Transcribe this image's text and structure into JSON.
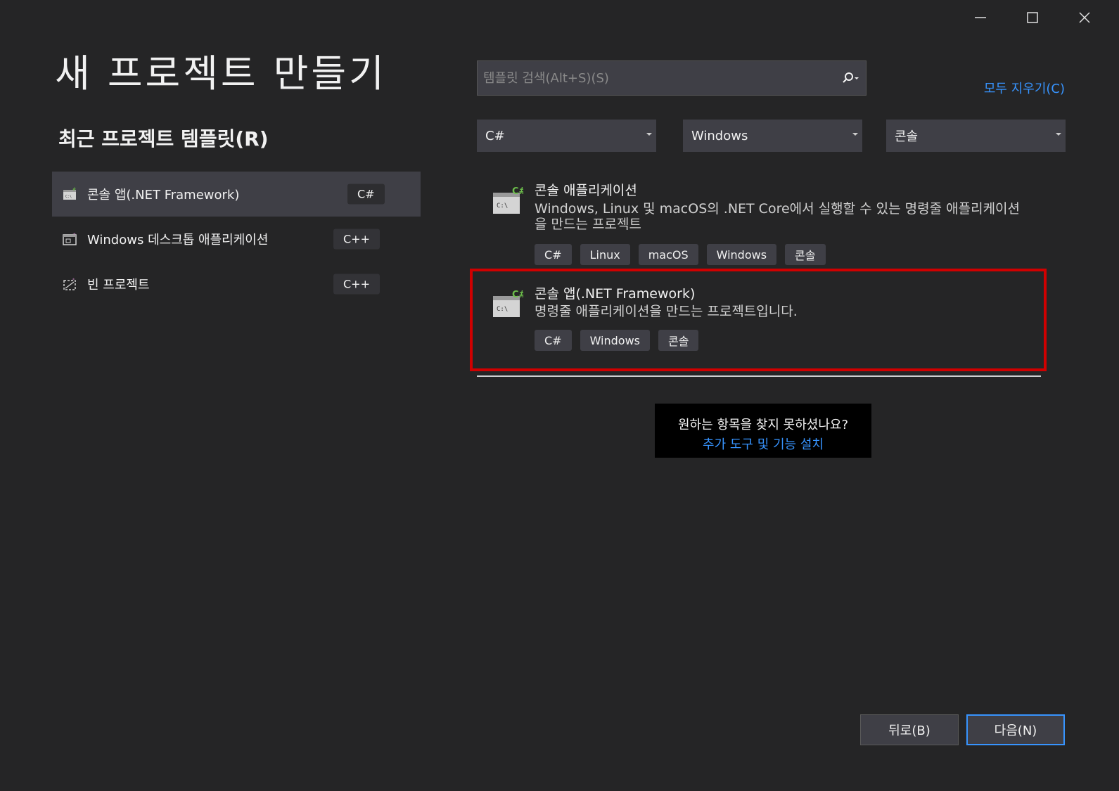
{
  "window": {
    "title": "새 프로젝트 만들기",
    "controls": [
      "minimize-icon",
      "maximize-icon",
      "close-icon"
    ]
  },
  "recent": {
    "heading": "최근 프로젝트 템플릿(R)",
    "items": [
      {
        "label": "콘솔 앱(.NET Framework)",
        "lang": "C#",
        "icon": "console-app-icon",
        "selected": true
      },
      {
        "label": "Windows 데스크톱 애플리케이션",
        "lang": "C++",
        "icon": "desktop-app-icon",
        "selected": false
      },
      {
        "label": "빈 프로젝트",
        "lang": "C++",
        "icon": "empty-project-icon",
        "selected": false
      }
    ]
  },
  "search": {
    "placeholder": "템플릿 검색(Alt+S)(S)",
    "value": "",
    "icon": "search-icon"
  },
  "clear_all_label": "모두 지우기(C)",
  "filters": {
    "language": "C#",
    "platform": "Windows",
    "project_type": "콘솔"
  },
  "templates": [
    {
      "name": "콘솔 애플리케이션",
      "description": "Windows, Linux 및 macOS의 .NET Core에서 실행할 수 있는 명령줄 애플리케이션을 만드는 프로젝트",
      "tags": [
        "C#",
        "Linux",
        "macOS",
        "Windows",
        "콘솔"
      ],
      "icon": "console-app-icon"
    },
    {
      "name": "콘솔 앱(.NET Framework)",
      "description": "명령줄 애플리케이션을 만드는 프로젝트입니다.",
      "tags": [
        "C#",
        "Windows",
        "콘솔"
      ],
      "icon": "console-app-icon",
      "highlighted": true
    }
  ],
  "not_found": {
    "question": "원하는 항목을 찾지 못하셨나요?",
    "link": "추가 도구 및 기능 설치"
  },
  "buttons": {
    "back": "뒤로(B)",
    "next": "다음(N)"
  },
  "colors": {
    "background": "#252526",
    "accent": "#3794ff",
    "highlight_border": "#d00000",
    "csharp_green": "#6dbf4b"
  }
}
